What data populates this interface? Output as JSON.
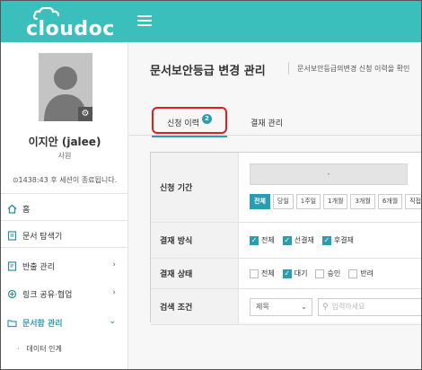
{
  "brand": {
    "logo_text": "cloudoc",
    "header_color": "#3bbfbd",
    "accent_color": "#2a9db0",
    "highlight_color": "#e02020"
  },
  "header": {
    "menu_icon": "hamburger-menu-icon"
  },
  "profile": {
    "name": "이지안 (jalee)",
    "role": "사원",
    "session": "⊙1438:43 후 세션이 종료됩니다."
  },
  "sidebar": {
    "items": [
      {
        "label": "홈",
        "icon": "home-icon"
      },
      {
        "label": "문서 탐색기",
        "icon": "document-icon"
      },
      {
        "label": "반출 관리",
        "icon": "export-icon",
        "chevron": "›"
      },
      {
        "label": "링크 공유·협업",
        "icon": "link-share-icon",
        "chevron": "›"
      },
      {
        "label": "문서함 관리",
        "icon": "folder-icon",
        "chevron": "⌄"
      }
    ],
    "sub_items": [
      {
        "label": "데이터 인계"
      }
    ]
  },
  "main": {
    "title": "문서보안등급 변경 관리",
    "description": "문서보안등급의변경 신청 이력을 확인",
    "tabs": [
      {
        "label": "신청 이력",
        "badge": "2"
      },
      {
        "label": "결재 관리"
      }
    ]
  },
  "form": {
    "period": {
      "label": "신청 기간",
      "date_value": "-",
      "buttons": [
        "전체",
        "당일",
        "1주일",
        "1개월",
        "3개월",
        "6개월",
        "직접입력"
      ],
      "active_button": "전체"
    },
    "approval_method": {
      "label": "결재 방식",
      "options": [
        {
          "label": "전체",
          "checked": true
        },
        {
          "label": "선결재",
          "checked": true
        },
        {
          "label": "후결재",
          "checked": true
        }
      ]
    },
    "approval_status": {
      "label": "결재 상태",
      "options": [
        {
          "label": "전체",
          "checked": false
        },
        {
          "label": "대기",
          "checked": true
        },
        {
          "label": "승인",
          "checked": false
        },
        {
          "label": "반려",
          "checked": false
        }
      ]
    },
    "search": {
      "label": "검색 조건",
      "select_value": "제목",
      "placeholder": "입력하세요"
    }
  }
}
